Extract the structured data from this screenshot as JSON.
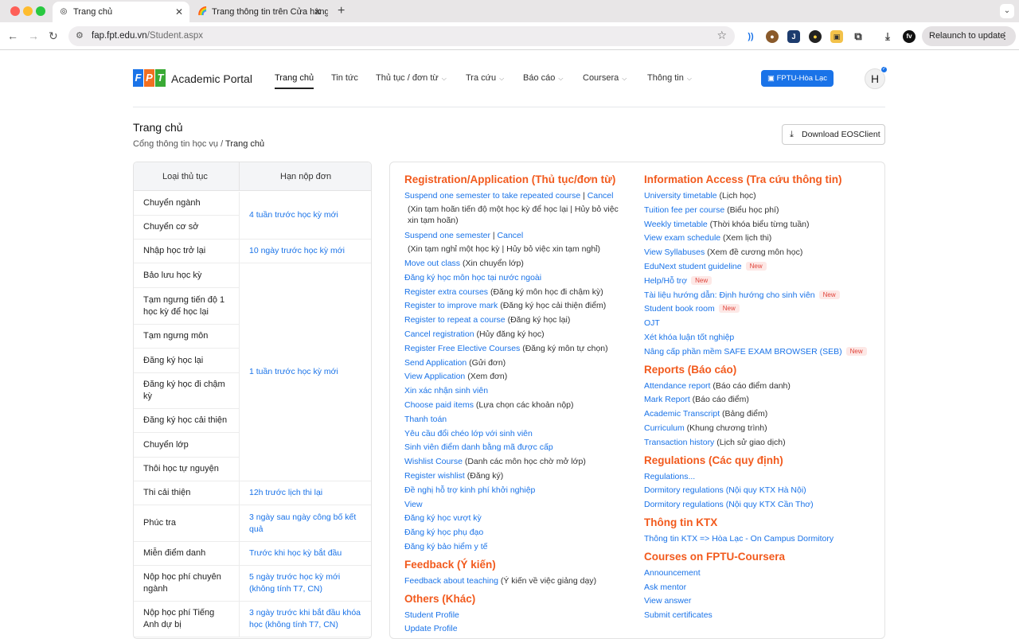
{
  "browser": {
    "tabs": [
      {
        "title": "Trang chủ",
        "active": true
      },
      {
        "title": "Trang thông tin trên Cửa hàng",
        "active": false
      }
    ],
    "url_host": "fap.fpt.edu.vn",
    "url_path": "/Student.aspx",
    "relaunch_label": "Relaunch to update"
  },
  "header": {
    "logo_letters": [
      "F",
      "P",
      "T"
    ],
    "portal_name": "Academic Portal",
    "nav": [
      {
        "label": "Trang chủ",
        "active": true,
        "dropdown": false
      },
      {
        "label": "Tin tức",
        "active": false,
        "dropdown": false
      },
      {
        "label": "Thủ tục / đơn từ",
        "active": false,
        "dropdown": true
      },
      {
        "label": "Tra cứu",
        "active": false,
        "dropdown": true
      },
      {
        "label": "Báo cáo",
        "active": false,
        "dropdown": true
      },
      {
        "label": "Coursera",
        "active": false,
        "dropdown": true
      },
      {
        "label": "Thông tin",
        "active": false,
        "dropdown": true
      }
    ],
    "campus_label": "FPTU-Hòa Lạc",
    "avatar_initial": "H"
  },
  "page": {
    "title": "Trang chủ",
    "breadcrumb_parent": "Cổng thông tin học vụ",
    "breadcrumb_sep": " / ",
    "breadcrumb_current": "Trang chủ",
    "download_label": "Download EOSClient"
  },
  "deadline_table": {
    "headers": [
      "Loại thủ tục",
      "Hạn nộp đơn"
    ],
    "rows": [
      "Chuyển ngành",
      "Chuyển cơ sở",
      "Nhập học trở lại",
      "Bảo lưu học kỳ",
      "Tạm ngưng tiến độ 1 học kỳ để học lại",
      "Tạm ngưng môn",
      "Đăng ký học lại",
      "Đăng ký học đi chậm kỳ",
      "Đăng ký học cải thiện",
      "Chuyển lớp",
      "Thôi học tự nguyện",
      "Thi cải thiện",
      "Phúc tra",
      "Miễn điểm danh",
      "Nộp học phí chuyên ngành",
      "Nộp học phí Tiếng Anh dự bị"
    ],
    "deadlines": [
      "4 tuần trước học kỳ mới",
      "10 ngày trước học kỳ mới",
      "1 tuần trước học kỳ mới",
      "12h trước lịch thi lại",
      "3 ngày sau ngày công bố kết quả",
      "Trước khi học kỳ bắt đầu",
      "5 ngày trước học kỳ mới (không tính T7, CN)",
      "3 ngày trước khi bắt đầu khóa học (không tính T7, CN)"
    ]
  },
  "left_column": {
    "registration": {
      "title": "Registration/Application (Thủ tục/đơn từ)",
      "items": [
        {
          "link": "Suspend one semester to take repeated course",
          "sep": " | ",
          "link2": "Cancel",
          "note": "(Xin tạm hoãn tiến độ một học kỳ để học lại | Hủy bỏ việc xin tạm hoãn)"
        },
        {
          "link": "Suspend one semester",
          "sep": " | ",
          "link2": "Cancel",
          "note": "(Xin tạm nghỉ một học kỳ | Hủy bỏ việc xin tạm nghỉ)"
        },
        {
          "link": "Move out class",
          "desc": " (Xin chuyển lớp)"
        },
        {
          "link": "Đăng ký học môn học tại nước ngoài"
        },
        {
          "link": "Register extra courses",
          "desc": " (Đăng ký môn học đi chậm kỳ)"
        },
        {
          "link": "Register to improve mark",
          "desc": " (Đăng ký học cải thiện điểm)"
        },
        {
          "link": "Register to repeat a course",
          "desc": " (Đăng ký học lại)"
        },
        {
          "link": "Cancel registration",
          "desc": " (Hủy đăng ký học)"
        },
        {
          "link": "Register Free Elective Courses",
          "desc": " (Đăng ký môn tự chọn)"
        },
        {
          "link": "Send Application",
          "desc": " (Gửi đơn)"
        },
        {
          "link": "View Application",
          "desc": " (Xem đơn)"
        },
        {
          "link": "Xin xác nhận sinh viên"
        },
        {
          "link": "Choose paid items",
          "desc": " (Lựa chọn các khoản nộp)"
        },
        {
          "link": "Thanh toán"
        },
        {
          "link": "Yêu cầu đổi chéo lớp với sinh viên"
        },
        {
          "link": "Sinh viên điểm danh bằng mã được cấp"
        },
        {
          "link": "Wishlist Course",
          "desc": " (Danh các môn học chờ mở lớp)"
        },
        {
          "link": "Register wishlist",
          "desc": " (Đăng ký)"
        },
        {
          "link": "Đề nghị hỗ trợ kinh phí khởi nghiệp"
        },
        {
          "link": "View"
        },
        {
          "link": "Đăng ký học vượt kỳ"
        },
        {
          "link": "Đăng ký học phụ đạo"
        },
        {
          "link": "Đăng ký bảo hiểm y tế"
        }
      ]
    },
    "feedback": {
      "title": "Feedback (Ý kiến)",
      "items": [
        {
          "link": "Feedback about teaching",
          "desc": " (Ý kiến về việc giảng dạy)"
        }
      ]
    },
    "others": {
      "title": "Others (Khác)",
      "items": [
        {
          "link": "Student Profile"
        },
        {
          "link": "Update Profile"
        }
      ]
    }
  },
  "right_column": {
    "information": {
      "title": "Information Access (Tra cứu thông tin)",
      "items": [
        {
          "link": "University timetable",
          "desc": " (Lịch học)"
        },
        {
          "link": "Tuition fee per course",
          "desc": " (Biểu học phí)"
        },
        {
          "link": "Weekly timetable",
          "desc": " (Thời khóa biểu từng tuần)"
        },
        {
          "link": "View exam schedule",
          "desc": " (Xem lịch thi)"
        },
        {
          "link": "View Syllabuses",
          "desc": " (Xem đề cương môn học)"
        },
        {
          "link": "EduNext student guideline",
          "badge": "New"
        },
        {
          "link": "Help/Hỗ trợ",
          "badge": "New"
        },
        {
          "link": "Tài liệu hướng dẫn: Định hướng cho sinh viên",
          "badge": "New"
        },
        {
          "link": "Student book room",
          "badge": "New"
        },
        {
          "link": "OJT"
        },
        {
          "link": "Xét khóa luận tốt nghiệp"
        },
        {
          "link": "Nâng cấp phần mềm SAFE EXAM BROWSER (SEB)",
          "badge": "New"
        }
      ]
    },
    "reports": {
      "title": "Reports (Báo cáo)",
      "items": [
        {
          "link": "Attendance report",
          "desc": " (Báo cáo điểm danh)"
        },
        {
          "link": "Mark Report",
          "desc": " (Báo cáo điểm)"
        },
        {
          "link": "Academic Transcript",
          "desc": " (Bảng điểm)"
        },
        {
          "link": "Curriculum",
          "desc": " (Khung chương trình)"
        },
        {
          "link": "Transaction history",
          "desc": " (Lịch sử giao dịch)"
        }
      ]
    },
    "regulations": {
      "title": "Regulations (Các quy định)",
      "items": [
        {
          "link": "Regulations..."
        },
        {
          "link": "Dormitory regulations (Nội quy KTX Hà Nội)"
        },
        {
          "link": "Dormitory regulations (Nội quy KTX Cần Thơ)"
        }
      ]
    },
    "ktx": {
      "title": "Thông tin KTX",
      "items": [
        {
          "link": "Thông tin KTX => Hòa Lạc - On Campus Dormitory"
        }
      ]
    },
    "coursera": {
      "title": "Courses on FPTU-Coursera",
      "items": [
        {
          "link": "Announcement"
        },
        {
          "link": "Ask mentor"
        },
        {
          "link": "View answer"
        },
        {
          "link": "Submit certificates"
        }
      ]
    }
  }
}
